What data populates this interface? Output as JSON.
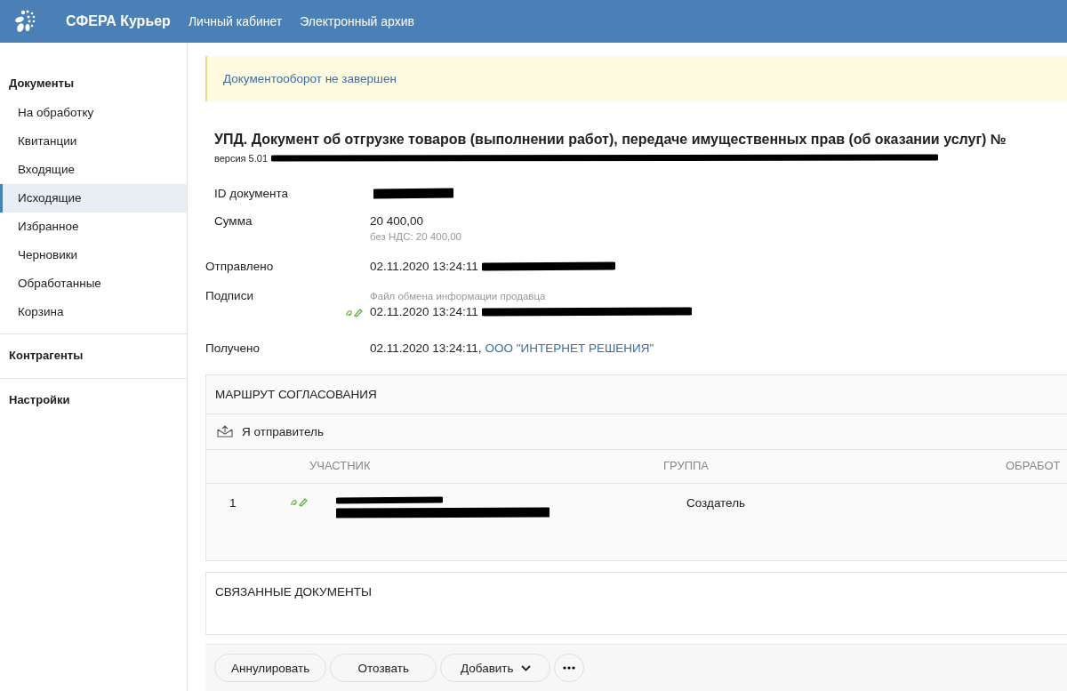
{
  "header": {
    "brand": "СФЕРА Курьер",
    "nav": [
      {
        "label": "Личный кабинет"
      },
      {
        "label": "Электронный архив"
      }
    ]
  },
  "sidebar": {
    "sections": [
      {
        "title": "Документы",
        "items": [
          {
            "label": "На обработку",
            "selected": false
          },
          {
            "label": "Квитанции",
            "selected": false
          },
          {
            "label": "Входящие",
            "selected": false
          },
          {
            "label": "Исходящие",
            "selected": true
          },
          {
            "label": "Избранное",
            "selected": false
          },
          {
            "label": "Черновики",
            "selected": false
          },
          {
            "label": "Обработанные",
            "selected": false
          },
          {
            "label": "Корзина",
            "selected": false
          }
        ]
      },
      {
        "title": "Контрагенты"
      },
      {
        "title": "Настройки"
      }
    ]
  },
  "alert": "Документооборот не завершен",
  "document": {
    "title": "УПД. Документ об отгрузке товаров (выполнении работ), передаче имущественных прав (об оказании услуг) №",
    "version": "версия 5.01",
    "id_label": "ID документа",
    "sum_label": "Сумма",
    "sum": "20 400,00",
    "sum_note": "без НДС: 20 400,00",
    "sent_label": "Отправлено",
    "sent": "02.11.2020 13:24:11",
    "signs_label": "Подписи",
    "sign_caption": "Файл обмена информации продавца",
    "sign_date": "02.11.2020 13:24:11",
    "received_label": "Получено",
    "received": "02.11.2020 13:24:11,",
    "received_org": "ООО \"ИНТЕРНЕТ РЕШЕНИЯ\""
  },
  "route": {
    "title": "МАРШРУТ СОГЛАСОВАНИЯ",
    "role": "Я отправитель",
    "columns": [
      "УЧАСТНИК",
      "ГРУППА",
      "ОБРАБОТ"
    ],
    "rows": [
      {
        "number": "1",
        "group": "Создатель"
      }
    ]
  },
  "related": {
    "title": "СВЯЗАННЫЕ ДОКУМЕНТЫ"
  },
  "actions": [
    {
      "label": "Аннулировать",
      "kind": "plain"
    },
    {
      "label": "Отозвать",
      "kind": "plain"
    },
    {
      "label": "Добавить",
      "kind": "dropdown"
    },
    {
      "kind": "more"
    }
  ]
}
